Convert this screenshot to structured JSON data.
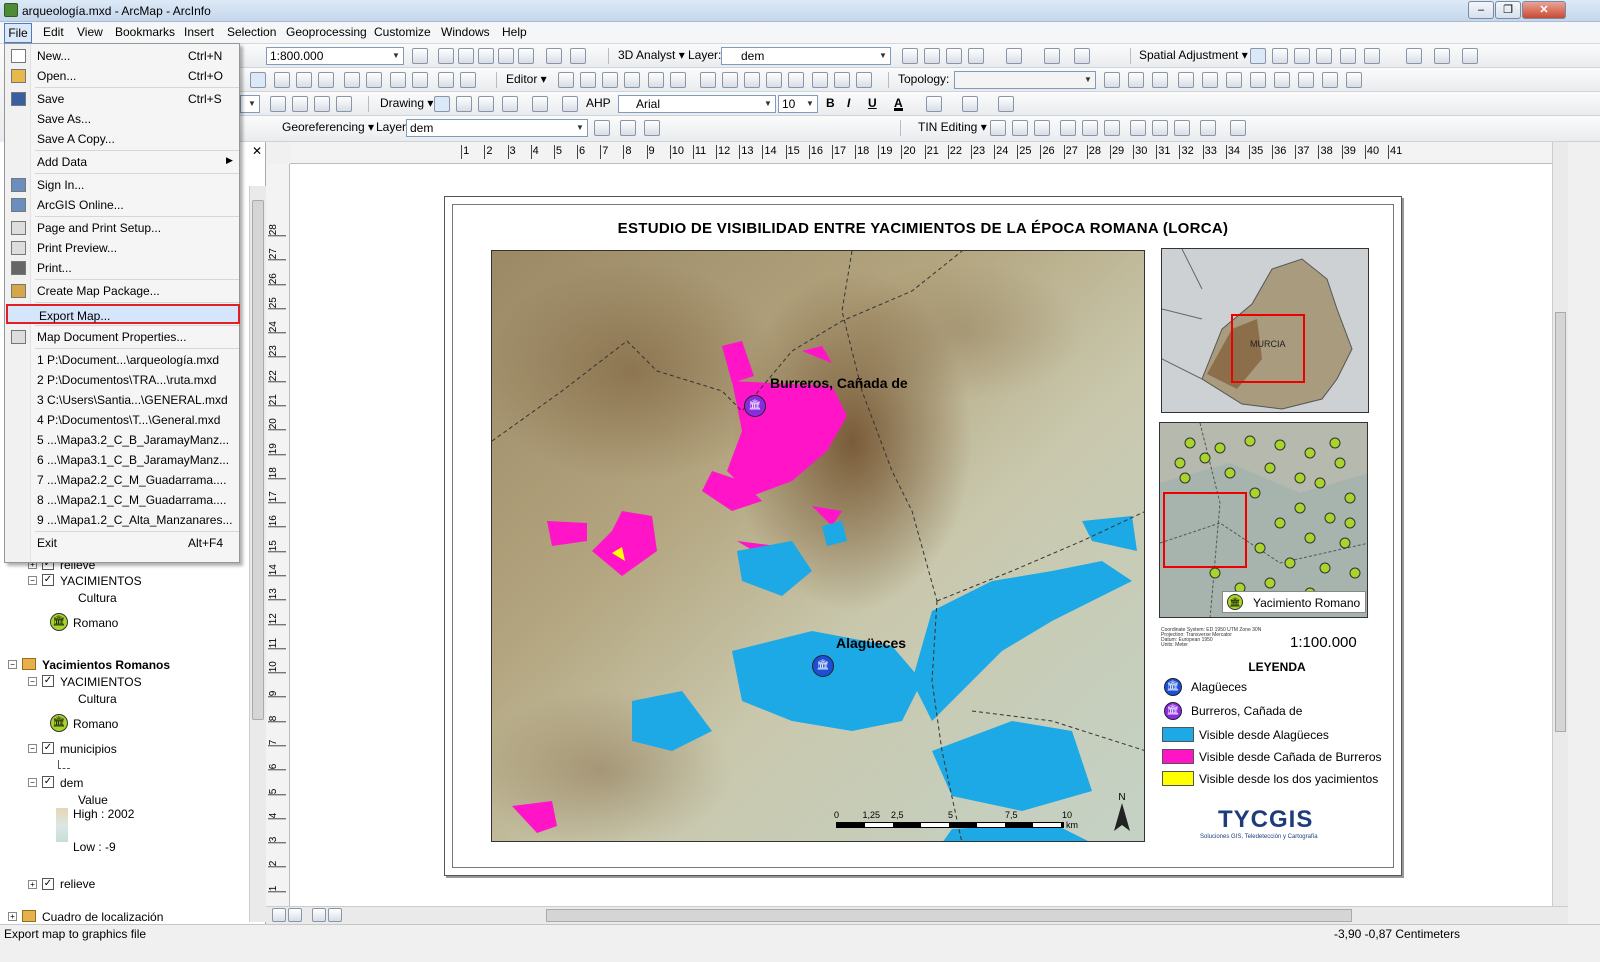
{
  "window": {
    "title": "arqueología.mxd - ArcMap - ArcInfo",
    "min": "‒",
    "max": "❐",
    "close": "✕"
  },
  "menubar": [
    "File",
    "Edit",
    "View",
    "Bookmarks",
    "Insert",
    "Selection",
    "Geoprocessing",
    "Customize",
    "Windows",
    "Help"
  ],
  "toolbar": {
    "scale": "1:800.000",
    "analyst3d": "3D Analyst ▾",
    "layer_label": "Layer:",
    "layer_value": "dem",
    "spatial_adjustment": "Spatial Adjustment ▾",
    "editor": "Editor ▾",
    "topology": "Topology:",
    "drawing": "Drawing ▾",
    "ahp": "AHP",
    "font": "Arial",
    "font_size": "10",
    "bold": "B",
    "italic": "I",
    "underline": "U",
    "font_color": "A",
    "georeferencing": "Georeferencing ▾",
    "geo_layer_label": "Layer:",
    "geo_layer_value": "dem",
    "tin_editing": "TIN Editing ▾"
  },
  "file_menu": [
    {
      "label": "New...",
      "shortcut": "Ctrl+N",
      "icon": "new-document-icon"
    },
    {
      "label": "Open...",
      "shortcut": "Ctrl+O",
      "icon": "open-folder-icon"
    },
    {
      "sep": true
    },
    {
      "label": "Save",
      "shortcut": "Ctrl+S",
      "icon": "save-icon"
    },
    {
      "label": "Save As...",
      "shortcut": ""
    },
    {
      "label": "Save A Copy...",
      "shortcut": ""
    },
    {
      "sep": true
    },
    {
      "label": "Add Data",
      "shortcut": "",
      "submenu": true
    },
    {
      "sep": true
    },
    {
      "label": "Sign In...",
      "shortcut": "",
      "icon": "sign-in-icon"
    },
    {
      "label": "ArcGIS Online...",
      "shortcut": "",
      "icon": "arcgis-online-icon"
    },
    {
      "sep": true
    },
    {
      "label": "Page and Print Setup...",
      "shortcut": "",
      "icon": "page-setup-icon"
    },
    {
      "label": "Print Preview...",
      "shortcut": "",
      "icon": "print-preview-icon"
    },
    {
      "label": "Print...",
      "shortcut": "",
      "icon": "print-icon"
    },
    {
      "sep": true
    },
    {
      "label": "Create Map Package...",
      "shortcut": "",
      "icon": "map-package-icon"
    },
    {
      "sep": true
    },
    {
      "label": "Export Map...",
      "shortcut": "",
      "highlight": true
    },
    {
      "sep": true
    },
    {
      "label": "Map Document Properties...",
      "shortcut": "",
      "icon": "document-properties-icon"
    },
    {
      "sep": true
    },
    {
      "label": "1 P:\\Document...\\arqueología.mxd",
      "shortcut": ""
    },
    {
      "label": "2 P:\\Documentos\\TRA...\\ruta.mxd",
      "shortcut": ""
    },
    {
      "label": "3 C:\\Users\\Santia...\\GENERAL.mxd",
      "shortcut": ""
    },
    {
      "label": "4 P:\\Documentos\\T...\\General.mxd",
      "shortcut": ""
    },
    {
      "label": "5 ...\\Mapa3.2_C_B_JaramayManz...",
      "shortcut": ""
    },
    {
      "label": "6 ...\\Mapa3.1_C_B_JaramayManz...",
      "shortcut": ""
    },
    {
      "label": "7 ...\\Mapa2.2_C_M_Guadarrama....",
      "shortcut": ""
    },
    {
      "label": "8 ...\\Mapa2.1_C_M_Guadarrama....",
      "shortcut": ""
    },
    {
      "label": "9 ...\\Mapa1.2_C_Alta_Manzanares...",
      "shortcut": ""
    },
    {
      "sep": true
    },
    {
      "label": "Exit",
      "shortcut": "Alt+F4"
    }
  ],
  "toc": {
    "relieve": "relieve",
    "yacimientos": "YACIMIENTOS",
    "cultura": "Cultura",
    "romano": "Romano",
    "group": "Yacimientos Romanos",
    "yacimientos2": "YACIMIENTOS",
    "cultura2": "Cultura",
    "romano2": "Romano",
    "municipios": "municipios",
    "dem": "dem",
    "value": "Value",
    "high": "High : 2002",
    "low": "Low : -9",
    "relieve2": "relieve",
    "cuadro": "Cuadro de localización",
    "close": "✕"
  },
  "ruler_h": [
    "1",
    "2",
    "3",
    "4",
    "5",
    "6",
    "7",
    "8",
    "9",
    "10",
    "11",
    "12",
    "13",
    "14",
    "15",
    "16",
    "17",
    "18",
    "19",
    "20",
    "21",
    "22",
    "23",
    "24",
    "25",
    "26",
    "27",
    "28",
    "29",
    "30",
    "31",
    "32",
    "33",
    "34",
    "35",
    "36",
    "37",
    "38",
    "39",
    "40",
    "41"
  ],
  "ruler_v": [
    "28",
    "27",
    "26",
    "25",
    "24",
    "23",
    "22",
    "21",
    "20",
    "19",
    "18",
    "17",
    "16",
    "15",
    "14",
    "13",
    "12",
    "11",
    "10",
    "9",
    "8",
    "7",
    "6",
    "5",
    "4",
    "3",
    "2",
    "1"
  ],
  "layout": {
    "title": "ESTUDIO DE VISIBILIDAD ENTRE YACIMIENTOS DE LA ÉPOCA ROMANA (LORCA)",
    "site1": "Burreros, Cañada de",
    "site2": "Alagüeces",
    "overview_label": "MURCIA",
    "yacimiento_romano": "Yacimiento Romano",
    "scale_text": "1:100.000",
    "coord_info": [
      "Coordinate System: ED 1950 UTM Zone 30N",
      "Projection: Transverse Mercator",
      "Datum: European 1950",
      "Units: Meter"
    ],
    "scalebar_labels": [
      "0",
      "1,25",
      "2,5",
      "5",
      "7,5",
      "10"
    ],
    "scalebar_unit": "km",
    "north": "N",
    "legend_title": "LEYENDA",
    "legend": [
      {
        "label": "Alagüeces",
        "type": "symbol",
        "color": "#1d4fd6"
      },
      {
        "label": "Burreros, Cañada de",
        "type": "symbol",
        "color": "#8a2be2"
      },
      {
        "label": "Visible desde Alagüeces",
        "type": "swatch",
        "color": "#1ca9e6"
      },
      {
        "label": "Visible desde Cañada de Burreros",
        "type": "swatch",
        "color": "#ff14c8"
      },
      {
        "label": "Visible desde los dos yacimientos",
        "type": "swatch",
        "color": "#ffff00"
      }
    ],
    "logo": "TYCGIS",
    "logo_sub": "Soluciones GIS, Teledetección y Cartografía"
  },
  "status": {
    "left": "Export map to graphics file",
    "coords": "-3,90  -0,87 Centimeters"
  }
}
